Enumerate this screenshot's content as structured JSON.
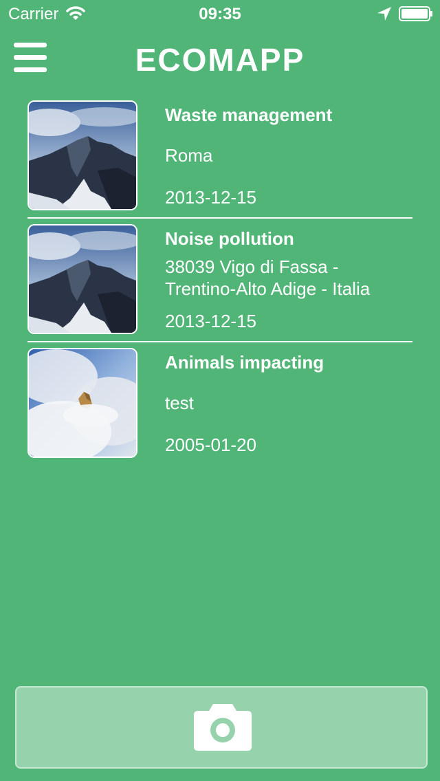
{
  "status_bar": {
    "carrier": "Carrier",
    "time": "09:35"
  },
  "nav": {
    "title": "ECOMAPP"
  },
  "reports": [
    {
      "title": "Waste management",
      "location": "Roma",
      "date": "2013-12-15",
      "photo": "mountain"
    },
    {
      "title": "Noise pollution",
      "location": "38039 Vigo di Fassa - Trentino-Alto Adige - Italia",
      "date": "2013-12-15",
      "photo": "mountain"
    },
    {
      "title": "Animals impacting",
      "location": "test",
      "date": "2005-01-20",
      "photo": "clouds"
    }
  ],
  "colors": {
    "background": "#52b578",
    "camera_button": "#96d2ac"
  },
  "icons": {
    "menu": "hamburger-icon",
    "camera": "camera-icon",
    "wifi": "wifi-icon",
    "location": "location-arrow-icon",
    "battery": "battery-icon"
  }
}
